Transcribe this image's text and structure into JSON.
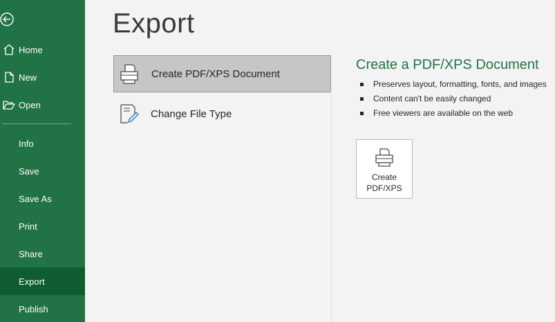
{
  "sidebar": {
    "top_items": [
      {
        "label": "Home",
        "icon": "home-icon"
      },
      {
        "label": "New",
        "icon": "new-file-icon"
      },
      {
        "label": "Open",
        "icon": "folder-open-icon"
      }
    ],
    "items": [
      {
        "label": "Info"
      },
      {
        "label": "Save"
      },
      {
        "label": "Save As"
      },
      {
        "label": "Print"
      },
      {
        "label": "Share"
      },
      {
        "label": "Export",
        "active": true
      },
      {
        "label": "Publish"
      }
    ],
    "accent": "#217346",
    "active_bg": "#0e5c30"
  },
  "page_title": "Export",
  "options": [
    {
      "label": "Create PDF/XPS Document",
      "icon": "pdf-document-icon",
      "selected": true
    },
    {
      "label": "Change File Type",
      "icon": "change-file-type-icon",
      "selected": false
    }
  ],
  "detail": {
    "title": "Create a PDF/XPS Document",
    "bullets": [
      "Preserves layout, formatting, fonts, and images",
      "Content can't be easily changed",
      "Free viewers are available on the web"
    ],
    "button_label": "Create\nPDF/XPS"
  }
}
